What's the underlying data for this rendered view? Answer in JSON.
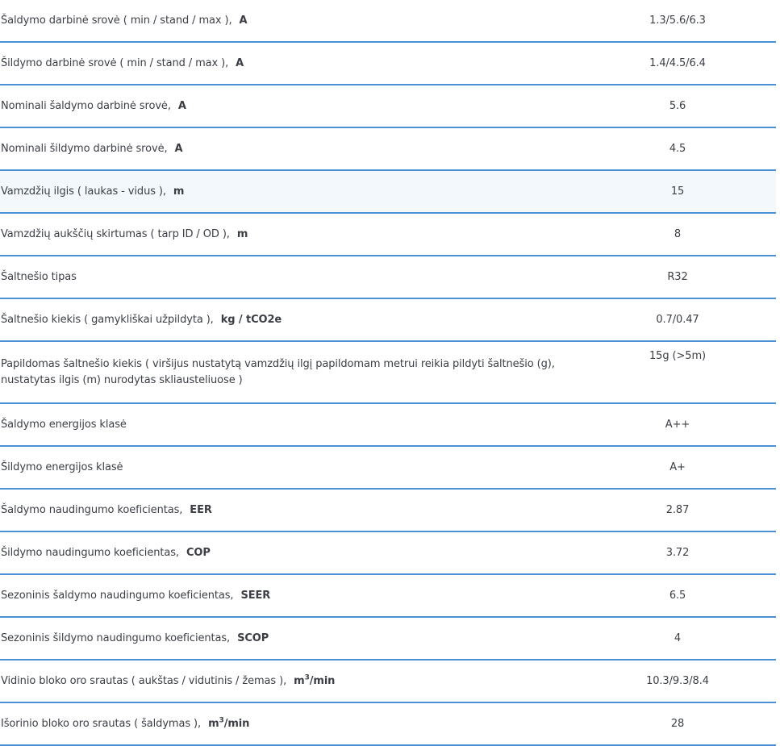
{
  "rows": [
    {
      "label": "Šaldymo darbinė srovė ( min / stand / max ),",
      "unit": "A",
      "value": "1.3/5.6/6.3"
    },
    {
      "label": "Šildymo darbinė srovė ( min / stand / max ),",
      "unit": "A",
      "value": "1.4/4.5/6.4"
    },
    {
      "label": "Nominali šaldymo darbinė srovė,",
      "unit": "A",
      "value": "5.6"
    },
    {
      "label": "Nominali šildymo darbinė srovė,",
      "unit": "A",
      "value": "4.5"
    },
    {
      "label": "Vamzdžių ilgis ( laukas - vidus ),",
      "unit": "m",
      "value": "15"
    },
    {
      "label": "Vamzdžių aukščių skirtumas ( tarp ID / OD ),",
      "unit": "m",
      "value": "8"
    },
    {
      "label": "Šaltnešio tipas",
      "unit": "",
      "value": "R32"
    },
    {
      "label": "Šaltnešio kiekis ( gamykliškai užpildyta ),",
      "unit": "kg / tCO2e",
      "value": "0.7/0.47"
    },
    {
      "label": "Papildomas šaltnešio kiekis ( viršijus nustatytą vamzdžių ilgį papildomam metrui reikia pildyti šaltnešio (g), nustatytas ilgis (m) nurodytas skliausteliuose )",
      "unit": "",
      "value": "15g (>5m)"
    },
    {
      "label": "Šaldymo energijos klasė",
      "unit": "",
      "value": "A++"
    },
    {
      "label": "Šildymo energijos klasė",
      "unit": "",
      "value": "A+"
    },
    {
      "label": "Šaldymo naudingumo koeficientas,",
      "unit": "EER",
      "value": "2.87"
    },
    {
      "label": "Šildymo naudingumo koeficientas,",
      "unit": "COP",
      "value": "3.72"
    },
    {
      "label": "Sezoninis šaldymo naudingumo koeficientas,",
      "unit": "SEER",
      "value": "6.5"
    },
    {
      "label": "Sezoninis šildymo naudingumo koeficientas,",
      "unit": "SCOP",
      "value": "4"
    },
    {
      "label": "Vidinio bloko oro srautas ( aukštas / vidutinis / žemas ),",
      "unit_base": "m",
      "unit_sup": "3",
      "unit_tail": "/min",
      "value": "10.3/9.3/8.4"
    },
    {
      "label": "Išorinio bloko oro srautas ( šaldymas ),",
      "unit_base": "m",
      "unit_sup": "3",
      "unit_tail": "/min",
      "value": "28"
    }
  ]
}
